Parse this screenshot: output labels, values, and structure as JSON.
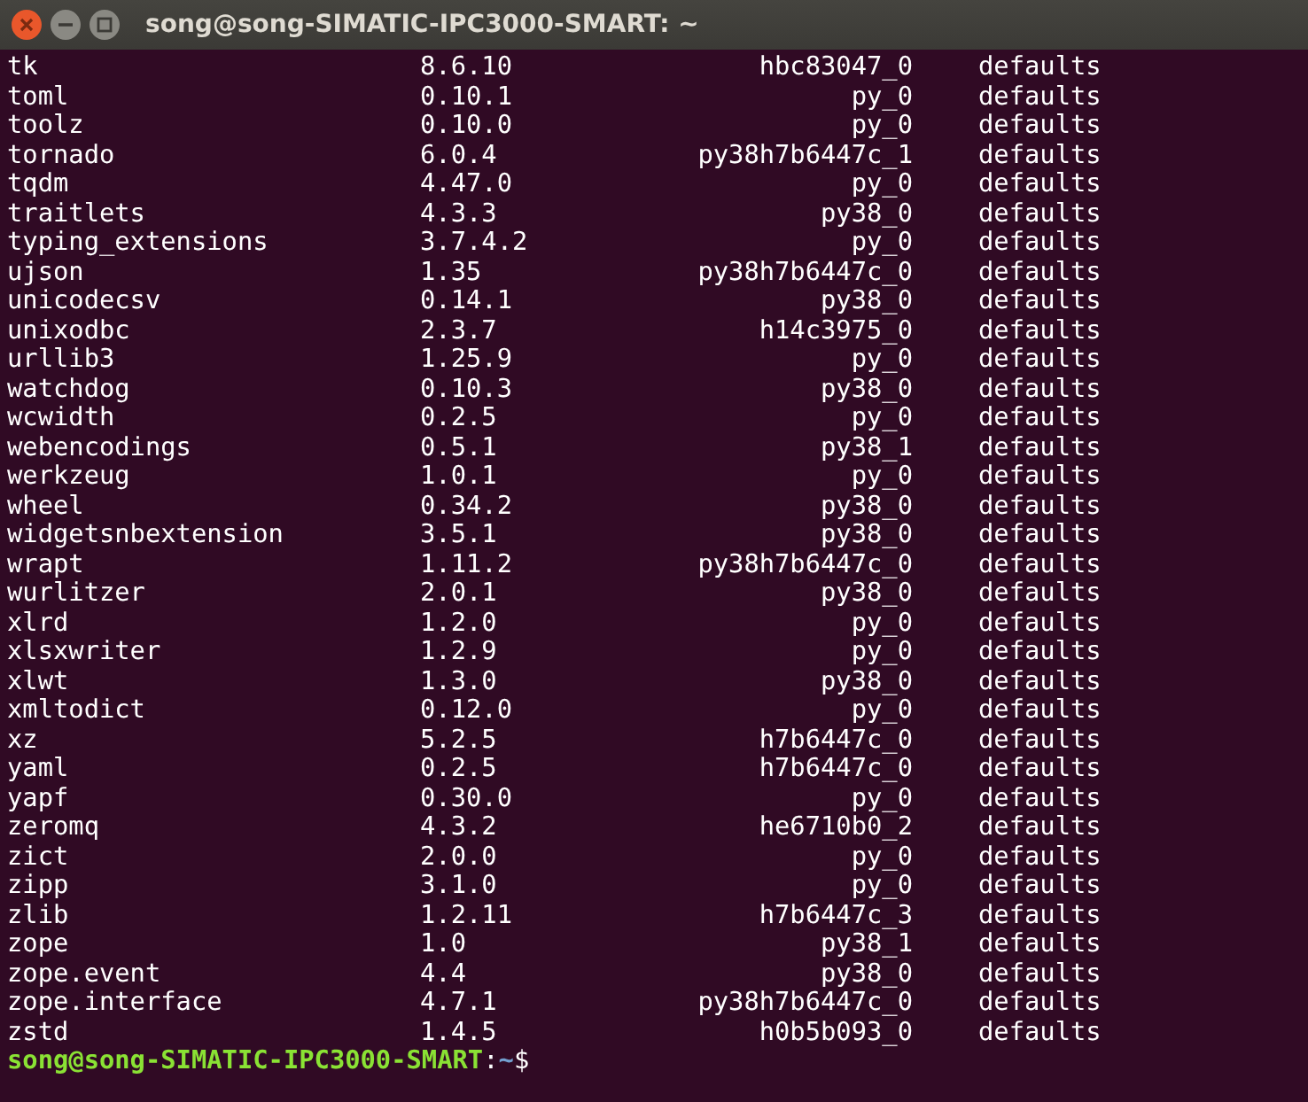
{
  "window": {
    "title": "song@song-SIMATIC-IPC3000-SMART: ~"
  },
  "packages": [
    {
      "name": "tk",
      "version": "8.6.10",
      "build": "hbc83047_0",
      "channel": "defaults"
    },
    {
      "name": "toml",
      "version": "0.10.1",
      "build": "py_0",
      "channel": "defaults"
    },
    {
      "name": "toolz",
      "version": "0.10.0",
      "build": "py_0",
      "channel": "defaults"
    },
    {
      "name": "tornado",
      "version": "6.0.4",
      "build": "py38h7b6447c_1",
      "channel": "defaults"
    },
    {
      "name": "tqdm",
      "version": "4.47.0",
      "build": "py_0",
      "channel": "defaults"
    },
    {
      "name": "traitlets",
      "version": "4.3.3",
      "build": "py38_0",
      "channel": "defaults"
    },
    {
      "name": "typing_extensions",
      "version": "3.7.4.2",
      "build": "py_0",
      "channel": "defaults"
    },
    {
      "name": "ujson",
      "version": "1.35",
      "build": "py38h7b6447c_0",
      "channel": "defaults"
    },
    {
      "name": "unicodecsv",
      "version": "0.14.1",
      "build": "py38_0",
      "channel": "defaults"
    },
    {
      "name": "unixodbc",
      "version": "2.3.7",
      "build": "h14c3975_0",
      "channel": "defaults"
    },
    {
      "name": "urllib3",
      "version": "1.25.9",
      "build": "py_0",
      "channel": "defaults"
    },
    {
      "name": "watchdog",
      "version": "0.10.3",
      "build": "py38_0",
      "channel": "defaults"
    },
    {
      "name": "wcwidth",
      "version": "0.2.5",
      "build": "py_0",
      "channel": "defaults"
    },
    {
      "name": "webencodings",
      "version": "0.5.1",
      "build": "py38_1",
      "channel": "defaults"
    },
    {
      "name": "werkzeug",
      "version": "1.0.1",
      "build": "py_0",
      "channel": "defaults"
    },
    {
      "name": "wheel",
      "version": "0.34.2",
      "build": "py38_0",
      "channel": "defaults"
    },
    {
      "name": "widgetsnbextension",
      "version": "3.5.1",
      "build": "py38_0",
      "channel": "defaults"
    },
    {
      "name": "wrapt",
      "version": "1.11.2",
      "build": "py38h7b6447c_0",
      "channel": "defaults"
    },
    {
      "name": "wurlitzer",
      "version": "2.0.1",
      "build": "py38_0",
      "channel": "defaults"
    },
    {
      "name": "xlrd",
      "version": "1.2.0",
      "build": "py_0",
      "channel": "defaults"
    },
    {
      "name": "xlsxwriter",
      "version": "1.2.9",
      "build": "py_0",
      "channel": "defaults"
    },
    {
      "name": "xlwt",
      "version": "1.3.0",
      "build": "py38_0",
      "channel": "defaults"
    },
    {
      "name": "xmltodict",
      "version": "0.12.0",
      "build": "py_0",
      "channel": "defaults"
    },
    {
      "name": "xz",
      "version": "5.2.5",
      "build": "h7b6447c_0",
      "channel": "defaults"
    },
    {
      "name": "yaml",
      "version": "0.2.5",
      "build": "h7b6447c_0",
      "channel": "defaults"
    },
    {
      "name": "yapf",
      "version": "0.30.0",
      "build": "py_0",
      "channel": "defaults"
    },
    {
      "name": "zeromq",
      "version": "4.3.2",
      "build": "he6710b0_2",
      "channel": "defaults"
    },
    {
      "name": "zict",
      "version": "2.0.0",
      "build": "py_0",
      "channel": "defaults"
    },
    {
      "name": "zipp",
      "version": "3.1.0",
      "build": "py_0",
      "channel": "defaults"
    },
    {
      "name": "zlib",
      "version": "1.2.11",
      "build": "h7b6447c_3",
      "channel": "defaults"
    },
    {
      "name": "zope",
      "version": "1.0",
      "build": "py38_1",
      "channel": "defaults"
    },
    {
      "name": "zope.event",
      "version": "4.4",
      "build": "py38_0",
      "channel": "defaults"
    },
    {
      "name": "zope.interface",
      "version": "4.7.1",
      "build": "py38h7b6447c_0",
      "channel": "defaults"
    },
    {
      "name": "zstd",
      "version": "1.4.5",
      "build": "h0b5b093_0",
      "channel": "defaults"
    }
  ],
  "prompt": {
    "user_host": "song@song-SIMATIC-IPC3000-SMART",
    "separator": ":",
    "path": "~",
    "symbol": "$"
  }
}
